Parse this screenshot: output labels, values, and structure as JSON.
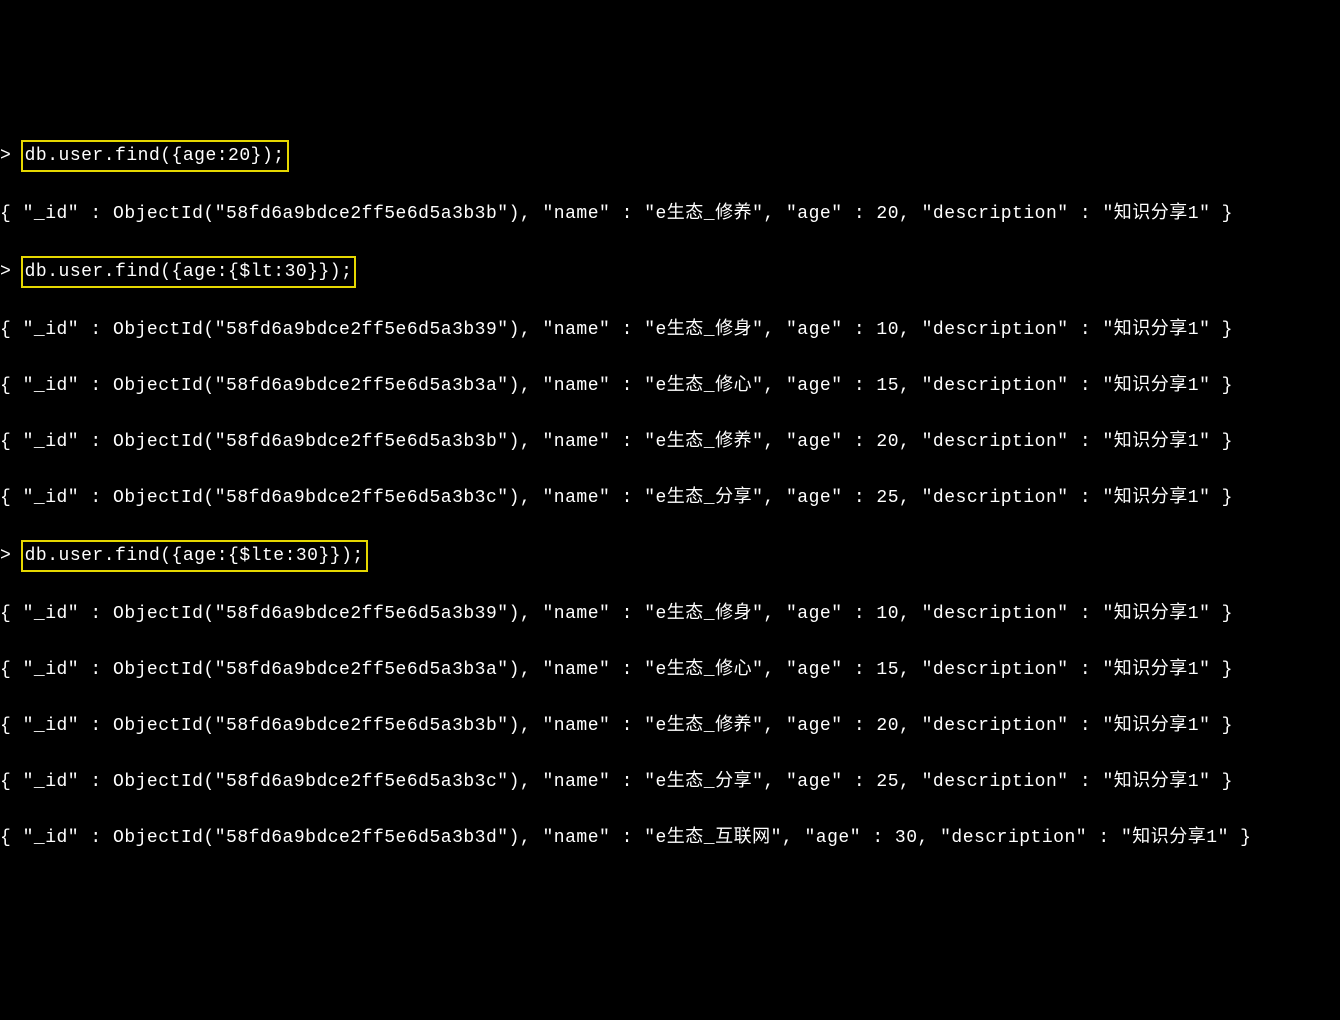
{
  "prompt": ">",
  "commands": {
    "cmd1": "db.user.find({age:20});",
    "cmd2": "db.user.find({age:{$lt:30}});",
    "cmd3": "db.user.find({age:{$lte:30}});"
  },
  "results": {
    "r1": "{ \"_id\" : ObjectId(\"58fd6a9bdce2ff5e6d5a3b3b\"), \"name\" : \"e生态_修养\", \"age\" : 20, \"description\" : \"知识分享1\" }",
    "r2a": "{ \"_id\" : ObjectId(\"58fd6a9bdce2ff5e6d5a3b39\"), \"name\" : \"e生态_修身\", \"age\" : 10, \"description\" : \"知识分享1\" }",
    "r2b": "{ \"_id\" : ObjectId(\"58fd6a9bdce2ff5e6d5a3b3a\"), \"name\" : \"e生态_修心\", \"age\" : 15, \"description\" : \"知识分享1\" }",
    "r2c": "{ \"_id\" : ObjectId(\"58fd6a9bdce2ff5e6d5a3b3b\"), \"name\" : \"e生态_修养\", \"age\" : 20, \"description\" : \"知识分享1\" }",
    "r2d": "{ \"_id\" : ObjectId(\"58fd6a9bdce2ff5e6d5a3b3c\"), \"name\" : \"e生态_分享\", \"age\" : 25, \"description\" : \"知识分享1\" }",
    "r3a": "{ \"_id\" : ObjectId(\"58fd6a9bdce2ff5e6d5a3b39\"), \"name\" : \"e生态_修身\", \"age\" : 10, \"description\" : \"知识分享1\" }",
    "r3b": "{ \"_id\" : ObjectId(\"58fd6a9bdce2ff5e6d5a3b3a\"), \"name\" : \"e生态_修心\", \"age\" : 15, \"description\" : \"知识分享1\" }",
    "r3c": "{ \"_id\" : ObjectId(\"58fd6a9bdce2ff5e6d5a3b3b\"), \"name\" : \"e生态_修养\", \"age\" : 20, \"description\" : \"知识分享1\" }",
    "r3d": "{ \"_id\" : ObjectId(\"58fd6a9bdce2ff5e6d5a3b3c\"), \"name\" : \"e生态_分享\", \"age\" : 25, \"description\" : \"知识分享1\" }",
    "r3e": "{ \"_id\" : ObjectId(\"58fd6a9bdce2ff5e6d5a3b3d\"), \"name\" : \"e生态_互联网\", \"age\" : 30, \"description\" : \"知识分享1\" }"
  }
}
